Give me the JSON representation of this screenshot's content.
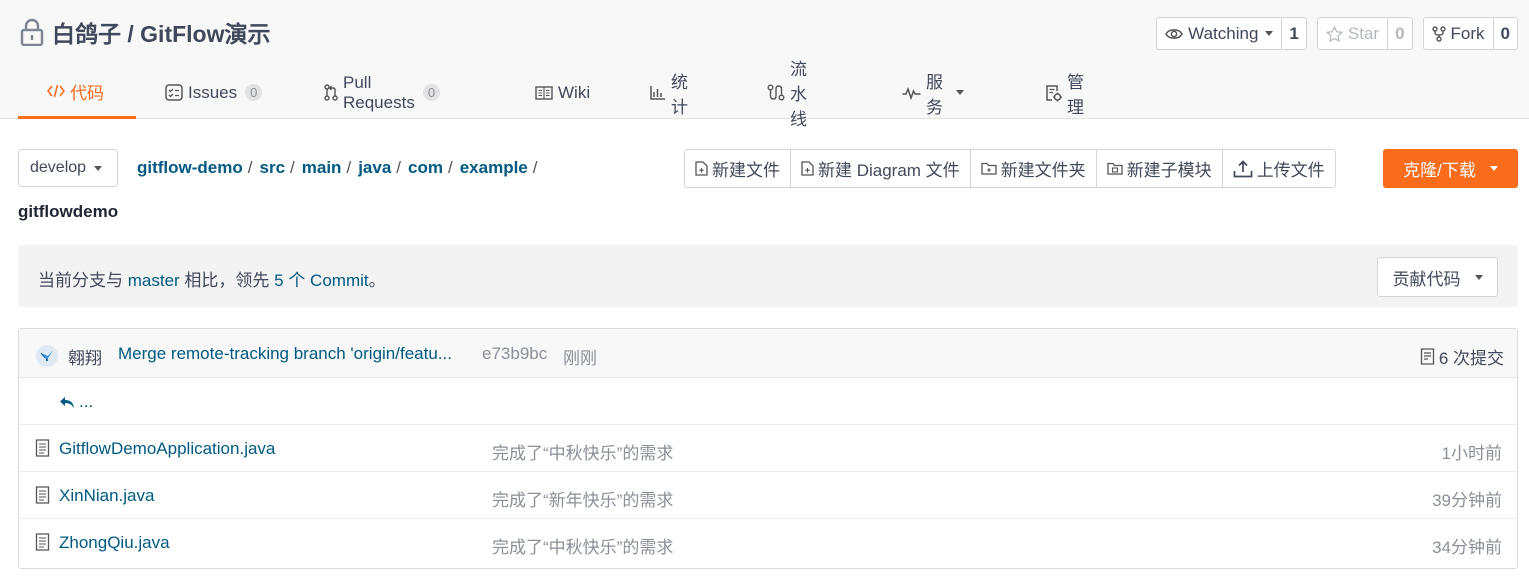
{
  "repo": {
    "title": "白鸽子 / GitFlow演示"
  },
  "actions": {
    "watch": {
      "label": "Watching",
      "count": "1"
    },
    "star": {
      "label": "Star",
      "count": "0"
    },
    "fork": {
      "label": "Fork",
      "count": "0"
    }
  },
  "tabs": [
    {
      "label": "代码",
      "active": true
    },
    {
      "label": "Issues",
      "badge": "0"
    },
    {
      "label": "Pull Requests",
      "badge": "0"
    },
    {
      "label": "Wiki"
    },
    {
      "label": "统计"
    },
    {
      "label": "流水线"
    },
    {
      "label": "服务"
    },
    {
      "label": "管理"
    }
  ],
  "branch": {
    "current": "develop"
  },
  "breadcrumb": {
    "parts": [
      "gitflow-demo",
      "src",
      "main",
      "java",
      "com",
      "example"
    ],
    "separator": "/",
    "current": "gitflowdemo"
  },
  "toolbar": {
    "new_file": "新建文件",
    "new_diagram": "新建 Diagram 文件",
    "new_folder": "新建文件夹",
    "new_submodule": "新建子模块",
    "upload": "上传文件",
    "clone": "克隆/下载"
  },
  "notice": {
    "prefix": "当前分支与 ",
    "base": "master",
    "middle": " 相比，领先 ",
    "ahead": "5 个 Commit",
    "suffix": "。",
    "contribute": "贡献代码"
  },
  "last_commit": {
    "author": "翱翔",
    "message": "Merge remote-tracking branch 'origin/featu...",
    "sha": "e73b9bc",
    "time": "刚刚",
    "count": "6 次提交"
  },
  "parent_link": "...",
  "files": [
    {
      "name": "GitflowDemoApplication.java",
      "message": "完成了“中秋快乐”的需求",
      "time": "1小时前"
    },
    {
      "name": "XinNian.java",
      "message": "完成了“新年快乐”的需求",
      "time": "39分钟前"
    },
    {
      "name": "ZhongQiu.java",
      "message": "完成了“中秋快乐”的需求",
      "time": "34分钟前"
    }
  ],
  "colors": {
    "accent": "#f86c1c",
    "link": "#005980"
  }
}
